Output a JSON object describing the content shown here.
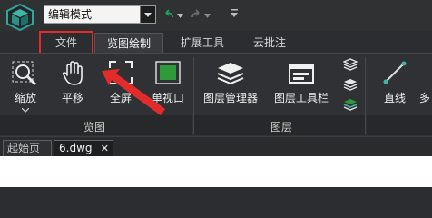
{
  "quick_access": {
    "mode_value": "编辑模式"
  },
  "tabs": [
    {
      "label": "文件"
    },
    {
      "label": "览图绘制"
    },
    {
      "label": "扩展工具"
    },
    {
      "label": "云批注"
    }
  ],
  "ribbon": {
    "buttons": [
      {
        "label": "缩放"
      },
      {
        "label": "平移"
      },
      {
        "label": "全屏"
      },
      {
        "label": "单视口"
      },
      {
        "label": "图层管理器"
      },
      {
        "label": "图层工具栏"
      },
      {
        "label": "直线"
      },
      {
        "label": "多"
      }
    ],
    "groups": [
      {
        "label": "览图"
      },
      {
        "label": "图层"
      }
    ]
  },
  "doc_tabs": [
    {
      "label": "起始页"
    },
    {
      "label": "6.dwg"
    }
  ],
  "doc_close_glyph": "✕",
  "colors": {
    "accent_red": "#e32b2b",
    "green": "#2e9a3a",
    "teal": "#3fb6a8",
    "canvas": "#ffffff"
  }
}
